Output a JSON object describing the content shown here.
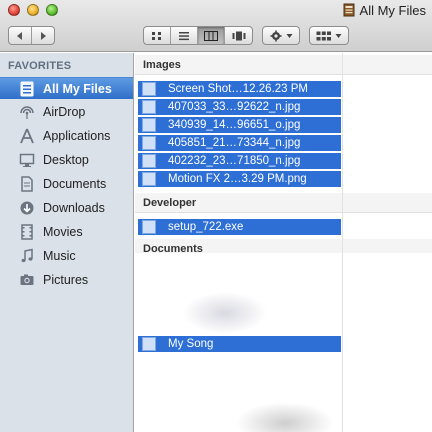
{
  "window": {
    "title": "All My Files",
    "close_color": "#e0443a",
    "minimize_color": "#eab12e",
    "zoom_color": "#5bbd2f",
    "accent": "#2e6fd6"
  },
  "toolbar": {
    "back_icon": "chevron-left-icon",
    "forward_icon": "chevron-right-icon",
    "view_modes": [
      "icon-view",
      "list-view",
      "column-view",
      "cover-flow-view"
    ],
    "active_view": "column-view",
    "action_icon": "gear-icon",
    "arrange_icon": "arrange-grid-icon"
  },
  "sidebar": {
    "heading": "FAVORITES",
    "items": [
      {
        "label": "All My Files",
        "icon": "all-my-files-icon",
        "selected": true
      },
      {
        "label": "AirDrop",
        "icon": "airdrop-icon"
      },
      {
        "label": "Applications",
        "icon": "applications-icon"
      },
      {
        "label": "Desktop",
        "icon": "desktop-icon"
      },
      {
        "label": "Documents",
        "icon": "documents-icon"
      },
      {
        "label": "Downloads",
        "icon": "downloads-icon"
      },
      {
        "label": "Movies",
        "icon": "movies-icon"
      },
      {
        "label": "Music",
        "icon": "music-icon"
      },
      {
        "label": "Pictures",
        "icon": "pictures-icon"
      }
    ]
  },
  "groups": {
    "images": {
      "header": "Images",
      "files": [
        "Screen Shot…12.26.23 PM",
        "407033_33…92622_n.jpg",
        "340939_14…96651_o.jpg",
        "405851_21…73344_n.jpg",
        "402232_23…71850_n.jpg",
        "Motion FX 2…3.29 PM.png"
      ]
    },
    "developer": {
      "header": "Developer",
      "files": [
        "setup_722.exe"
      ]
    },
    "documents": {
      "header": "Documents",
      "files": [
        "My Song"
      ]
    }
  }
}
